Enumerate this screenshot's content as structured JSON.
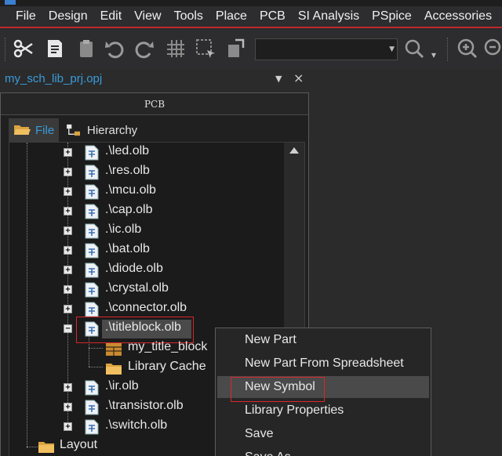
{
  "menubar": {
    "items": [
      "File",
      "Design",
      "Edit",
      "View",
      "Tools",
      "Place",
      "PCB",
      "SI Analysis",
      "PSpice",
      "Accessories"
    ]
  },
  "toolbar": {
    "buttons": [
      "scissors-icon",
      "copy-icon",
      "paste-icon",
      "undo-icon",
      "redo-icon",
      "grid-icon",
      "select-area-icon",
      "place-icon"
    ],
    "search_icon": "search-icon",
    "zoom_icons": [
      "zoom-in-icon",
      "zoom-out-icon"
    ]
  },
  "project": {
    "title": "my_sch_lib_prj.opj",
    "pin_glyph": "▼",
    "close_glyph": "×"
  },
  "panel": {
    "title": "PCB",
    "tabs": [
      {
        "label": "File",
        "active": true
      },
      {
        "label": "Hierarchy",
        "active": false
      }
    ]
  },
  "tree": {
    "items": [
      {
        "label": ".\\led.olb",
        "expander": "+"
      },
      {
        "label": ".\\res.olb",
        "expander": "+"
      },
      {
        "label": ".\\mcu.olb",
        "expander": "+"
      },
      {
        "label": ".\\cap.olb",
        "expander": "+"
      },
      {
        "label": ".\\ic.olb",
        "expander": "+"
      },
      {
        "label": ".\\bat.olb",
        "expander": "+"
      },
      {
        "label": ".\\diode.olb",
        "expander": "+"
      },
      {
        "label": ".\\crystal.olb",
        "expander": "+"
      },
      {
        "label": ".\\connector.olb",
        "expander": "+"
      },
      {
        "label": ".\\titleblock.olb",
        "expander": "−",
        "selected": true
      },
      {
        "label": "my_title_block",
        "child": true,
        "icon": "title-block-icon"
      },
      {
        "label": "Library Cache",
        "child": true,
        "icon": "folder-icon"
      },
      {
        "label": ".\\ir.olb",
        "expander": "+"
      },
      {
        "label": ".\\transistor.olb",
        "expander": "+"
      },
      {
        "label": ".\\switch.olb",
        "expander": "+"
      },
      {
        "label": "Layout",
        "root": true,
        "icon": "folder-icon"
      }
    ]
  },
  "context_menu": {
    "items": [
      {
        "label": "New Part"
      },
      {
        "label": "New Part From Spreadsheet"
      },
      {
        "label": "New Symbol",
        "hover": true
      },
      {
        "label": "Library Properties"
      },
      {
        "label": "Save"
      },
      {
        "label": "Save As..."
      }
    ]
  },
  "colors": {
    "accent_blue": "#3a9bdc",
    "highlight_red": "#d9262b",
    "background": "#2b2b2b"
  }
}
